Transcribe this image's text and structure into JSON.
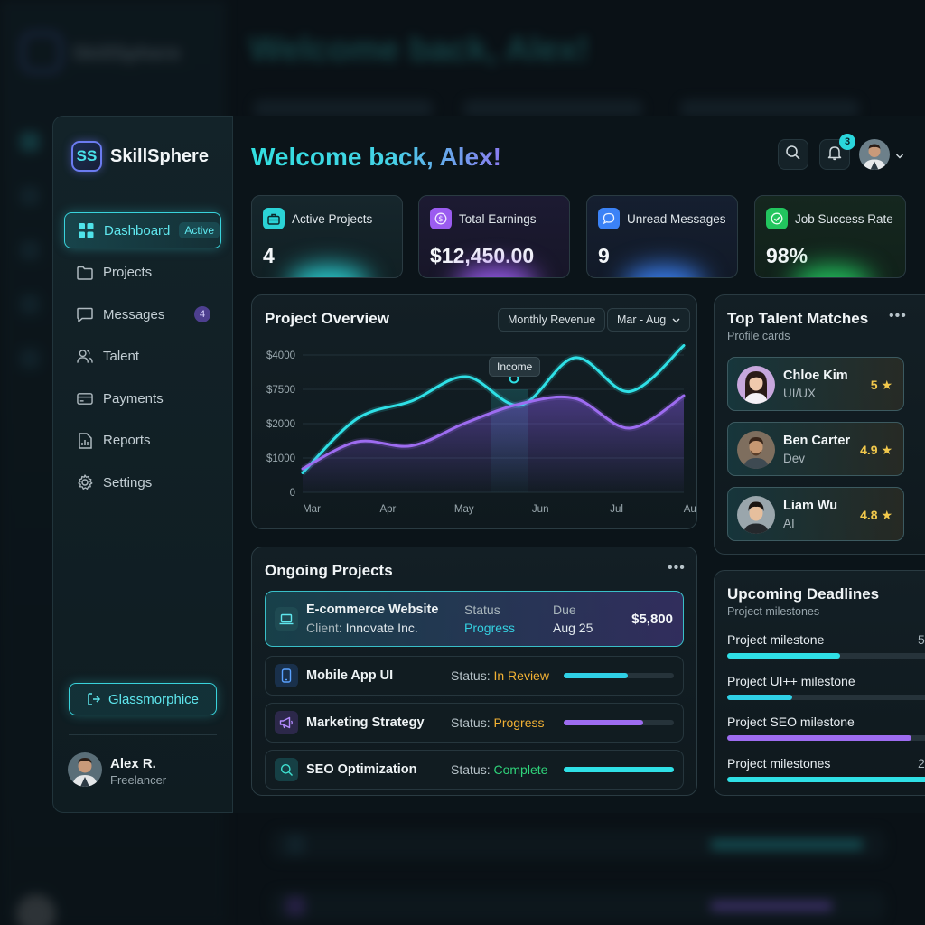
{
  "brand": {
    "logo_text": "SS",
    "name": "SkillSphere"
  },
  "sidebar": {
    "items": [
      {
        "label": "Dashboard",
        "tag": "Active",
        "icon": "grid-icon"
      },
      {
        "label": "Projects",
        "icon": "folder-icon"
      },
      {
        "label": "Messages",
        "badge": "4",
        "icon": "chat-icon"
      },
      {
        "label": "Talent",
        "icon": "users-icon"
      },
      {
        "label": "Payments",
        "icon": "card-icon"
      },
      {
        "label": "Reports",
        "icon": "report-icon"
      },
      {
        "label": "Settings",
        "icon": "gear-icon"
      }
    ],
    "glass_button": "Glassmorphice",
    "user": {
      "name": "Alex R.",
      "role": "Freelancer"
    }
  },
  "header": {
    "welcome": "Welcome back, Alex!",
    "notification_count": "3"
  },
  "stats": [
    {
      "label": "Active Projects",
      "value": "4",
      "icon": "briefcase-icon",
      "color": "#2bd3d6"
    },
    {
      "label": "Total Earnings",
      "value": "$12,450.00",
      "icon": "dollar-icon",
      "color": "#9b5cf0"
    },
    {
      "label": "Unread Messages",
      "value": "9",
      "icon": "message-icon",
      "color": "#3b82f6"
    },
    {
      "label": "Job Success Rate",
      "value": "98%",
      "icon": "check-icon",
      "color": "#22c55e"
    }
  ],
  "overview": {
    "title": "Project Overview",
    "filter": "Monthly Revenue",
    "range": "Mar - Aug",
    "tooltip": "Income"
  },
  "chart_data": {
    "type": "line",
    "categories": [
      "Mar",
      "Apr",
      "May",
      "Jun",
      "Jul",
      "Aug"
    ],
    "y_tick_labels": [
      "$4000",
      "$7500",
      "$2000",
      "$1000",
      "0"
    ],
    "series": [
      {
        "color": "#2fe0e6",
        "values": [
          0.05,
          0.45,
          0.58,
          0.76,
          0.55,
          0.9,
          0.65,
          0.99
        ]
      },
      {
        "color": "#9d6cf0",
        "values": [
          0.08,
          0.28,
          0.25,
          0.42,
          0.56,
          0.6,
          0.38,
          0.62
        ]
      }
    ],
    "grid": true
  },
  "ongoing": {
    "title": "Ongoing Projects",
    "featured": {
      "name": "E-commerce Website",
      "client_label": "Client:",
      "client": "Innovate Inc.",
      "status_label": "Status",
      "status": "Progress",
      "due_label": "Due",
      "due": "Aug 25",
      "amount": "$5,800"
    },
    "rows": [
      {
        "name": "Mobile App UI",
        "status_label": "Status:",
        "status": "In Review",
        "status_color": "#f2b134",
        "progress": 0.58,
        "bar_color": "#2fd0e6",
        "icon": "phone-icon",
        "icon_color": "#3b82f6"
      },
      {
        "name": "Marketing Strategy",
        "status_label": "Status:",
        "status": "Progress",
        "status_color": "#f2b134",
        "progress": 0.72,
        "bar_color": "#9d6cf0",
        "icon": "megaphone-icon",
        "icon_color": "#9b5cf0"
      },
      {
        "name": "SEO Optimization",
        "status_label": "Status:",
        "status": "Complete",
        "status_color": "#2fd37a",
        "progress": 1.0,
        "bar_color": "#2fe0e6",
        "icon": "search-icon",
        "icon_color": "#2bd3d6"
      }
    ]
  },
  "talent": {
    "title": "Top Talent Matches",
    "subtitle": "Profile cards",
    "items": [
      {
        "name": "Chloe Kim",
        "role": "UI/UX",
        "rating": "5"
      },
      {
        "name": "Ben Carter",
        "role": "Dev",
        "rating": "4.9"
      },
      {
        "name": "Liam Wu",
        "role": "AI",
        "rating": "4.8"
      }
    ]
  },
  "deadlines": {
    "title": "Upcoming Deadlines",
    "subtitle": "Project milestones",
    "items": [
      {
        "label": "Project milestone",
        "value": "5",
        "progress": 0.52,
        "color": "#2fe0e6"
      },
      {
        "label": "Project UI++ milestone",
        "value": "",
        "progress": 0.3,
        "color": "#2fd0e6"
      },
      {
        "label": "Project SEO milestone",
        "value": "",
        "progress": 0.85,
        "color": "#9d6cf0"
      },
      {
        "label": "Project milestones",
        "value": "2",
        "progress": 0.96,
        "color": "#2fe0e6"
      }
    ]
  }
}
